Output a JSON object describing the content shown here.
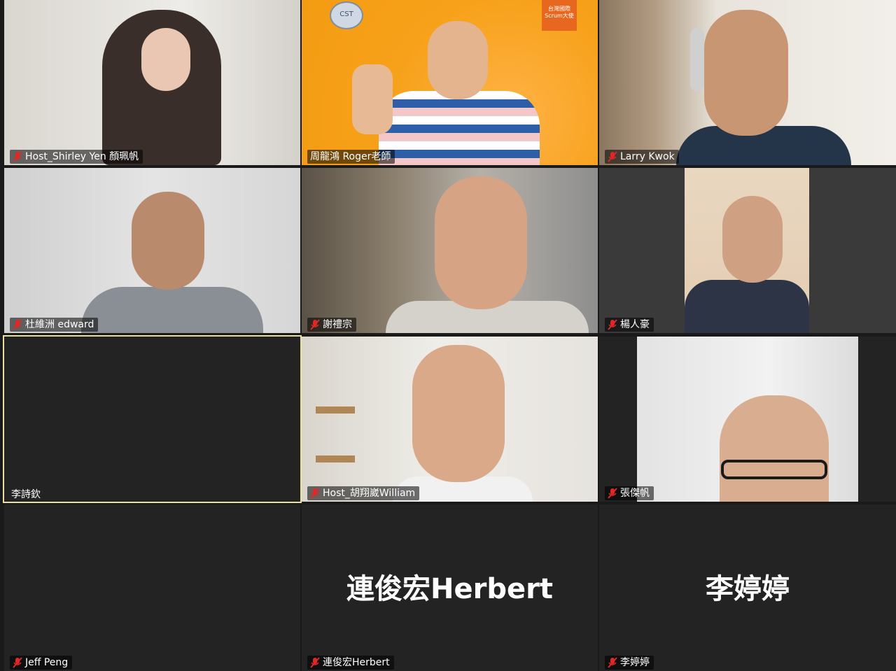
{
  "participants": [
    {
      "name": "Host_Shirley Yen 顏珮帆",
      "muted": true,
      "video": true
    },
    {
      "name": "周龍鴻 Roger老師",
      "muted": false,
      "video": true
    },
    {
      "name": "Larry Kwok",
      "muted": true,
      "video": true
    },
    {
      "name": "杜維洲 edward",
      "muted": true,
      "video": true
    },
    {
      "name": "謝禮宗",
      "muted": true,
      "video": true
    },
    {
      "name": "楊人豪",
      "muted": true,
      "video": true
    },
    {
      "name": "李詩欽",
      "muted": false,
      "video": false,
      "active_speaker": true
    },
    {
      "name": "Host_胡翔崴William",
      "muted": true,
      "video": true
    },
    {
      "name": "張傑帆",
      "muted": true,
      "video": true
    },
    {
      "name": "Jeff Peng",
      "muted": true,
      "video": false
    },
    {
      "name": "連俊宏Herbert",
      "muted": true,
      "video": false,
      "display_name": "連俊宏Herbert"
    },
    {
      "name": "李婷婷",
      "muted": true,
      "video": false,
      "display_name": "李婷婷"
    }
  ],
  "badges": {
    "cst": "CST",
    "flag": "台灣國際 Scrum大使"
  },
  "colors": {
    "mute_icon": "#e02828",
    "active_border": "#e8e0a0",
    "tile_bg": "#232323"
  }
}
